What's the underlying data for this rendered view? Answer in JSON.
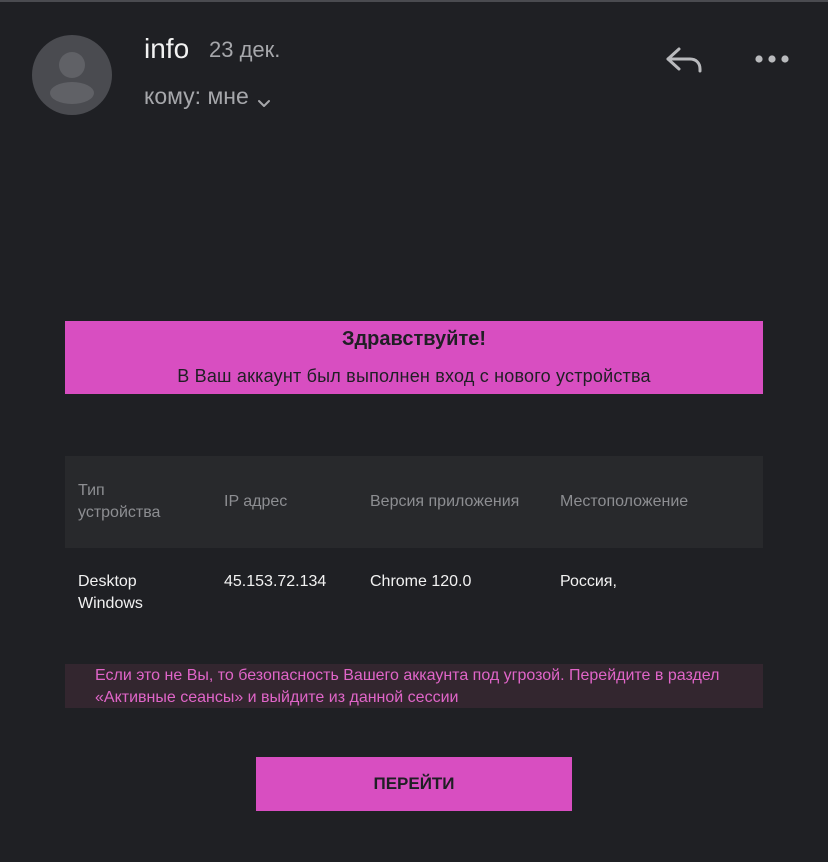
{
  "header": {
    "sender": "info",
    "date": "23 дек.",
    "recipient": "кому: мне",
    "icons": [
      "avatar-icon",
      "chevron-down-icon",
      "reply-icon",
      "more-icon"
    ]
  },
  "banner": {
    "title": "Здравствуйте!",
    "subtitle": "В Ваш аккаунт был выполнен вход с нового устройства"
  },
  "table": {
    "headers": [
      {
        "line1": "Тип",
        "line2": "устройства"
      },
      {
        "line1": "IP адрес",
        "line2": ""
      },
      {
        "line1": "Версия приложения",
        "line2": ""
      },
      {
        "line1": "Местоположение",
        "line2": ""
      }
    ],
    "row": [
      {
        "line1": "Desktop",
        "line2": "Windows"
      },
      {
        "line1": "45.153.72.134",
        "line2": ""
      },
      {
        "line1": "Chrome 120.0",
        "line2": ""
      },
      {
        "line1": "Россия,",
        "line2": ""
      }
    ]
  },
  "warning": {
    "text": "Если это не Вы, то безопасность Вашего аккаунта под угрозой. Перейдите в раздел «Активные сеансы» и выйдите из данной сессии"
  },
  "action": {
    "button_label": "ПЕРЕЙТИ"
  },
  "colors": {
    "background": "#1f2024",
    "accent": "#d84ec1",
    "table_header_bg": "#28292c",
    "warning_bg": "#33262f",
    "warning_text": "#e065c8"
  }
}
